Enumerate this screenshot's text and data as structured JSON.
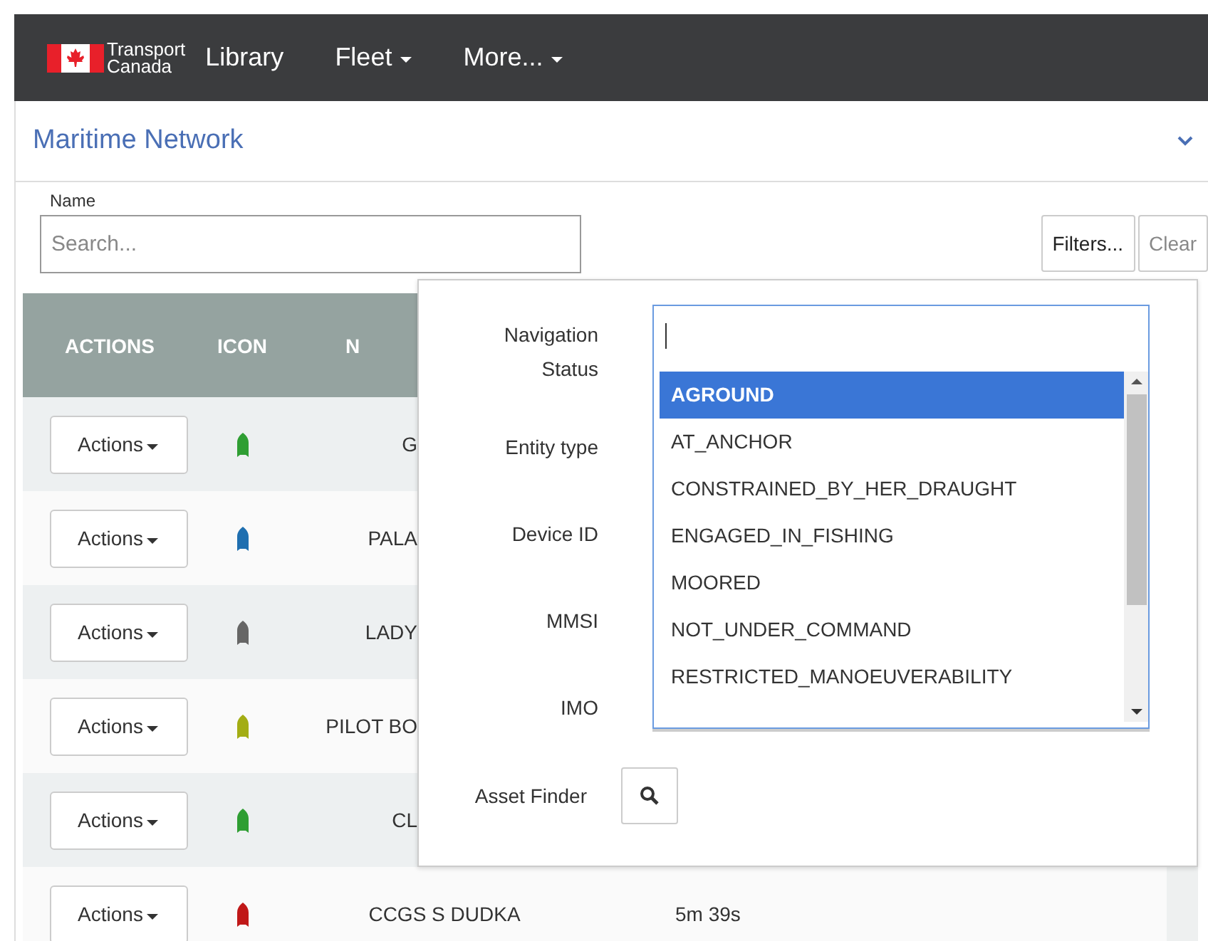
{
  "nav": {
    "logo_lines": [
      "Transport",
      "Canada"
    ],
    "items": [
      {
        "label": "Library",
        "dropdown": false
      },
      {
        "label": "Fleet",
        "dropdown": true
      },
      {
        "label": "More...",
        "dropdown": true
      }
    ]
  },
  "panel": {
    "title": "Maritime Network"
  },
  "search": {
    "label": "Name",
    "placeholder": "Search..."
  },
  "buttons": [
    {
      "label": "Filters...",
      "disabled": false
    },
    {
      "label": "Clear",
      "disabled": true
    }
  ],
  "table": {
    "columns": [
      "ACTIONS",
      "ICON",
      "N"
    ],
    "rows": [
      {
        "action": "Actions",
        "color": "#2f9e33",
        "name": "G"
      },
      {
        "action": "Actions",
        "color": "#1f6fb0",
        "name": "PALA"
      },
      {
        "action": "Actions",
        "color": "#666666",
        "name": "LADY"
      },
      {
        "action": "Actions",
        "color": "#a3ad14",
        "name": "PILOT BO"
      },
      {
        "action": "Actions",
        "color": "#2f9e33",
        "name": "CL"
      },
      {
        "action": "Actions",
        "color": "#c01818",
        "name": "CCGS S DUDKA",
        "time": "5m 39s"
      }
    ]
  },
  "filters": {
    "navigation_status": {
      "label": "Navigation Status",
      "options": [
        {
          "label": "AGROUND",
          "selected": true
        },
        {
          "label": "AT_ANCHOR",
          "selected": false
        },
        {
          "label": "CONSTRAINED_BY_HER_DRAUGHT",
          "selected": false
        },
        {
          "label": "ENGAGED_IN_FISHING",
          "selected": false
        },
        {
          "label": "MOORED",
          "selected": false
        },
        {
          "label": "NOT_UNDER_COMMAND",
          "selected": false
        },
        {
          "label": "RESTRICTED_MANOEUVERABILITY",
          "selected": false
        }
      ]
    },
    "other_fields": [
      "Entity type",
      "Device ID",
      "MMSI",
      "IMO"
    ],
    "asset_finder": "Asset Finder"
  }
}
